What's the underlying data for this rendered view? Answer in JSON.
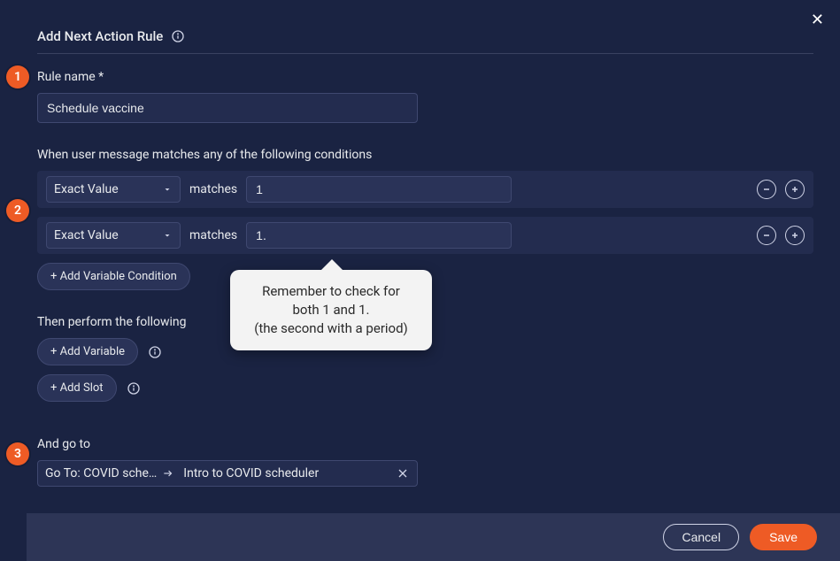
{
  "dialog": {
    "title": "Add Next Action Rule"
  },
  "step_badges": [
    "1",
    "2",
    "3"
  ],
  "rule_name": {
    "label": "Rule name *",
    "value": "Schedule vaccine"
  },
  "conditions": {
    "header": "When user message matches any of the following conditions",
    "rows": [
      {
        "type": "Exact Value",
        "joiner": "matches",
        "value": "1"
      },
      {
        "type": "Exact Value",
        "joiner": "matches",
        "value": "1."
      }
    ],
    "add_variable_condition": "+ Add Variable Condition"
  },
  "actions": {
    "header": "Then perform the following",
    "add_variable": "+ Add Variable",
    "add_slot": "+ Add Slot"
  },
  "goto": {
    "header": "And go to",
    "prefix": "Go To: COVID sche…",
    "target": "Intro to COVID scheduler"
  },
  "footer": {
    "cancel": "Cancel",
    "save": "Save"
  },
  "tooltip": {
    "line1": "Remember to check for",
    "line2": "both 1 and 1.",
    "line3": "(the second with a period)"
  }
}
